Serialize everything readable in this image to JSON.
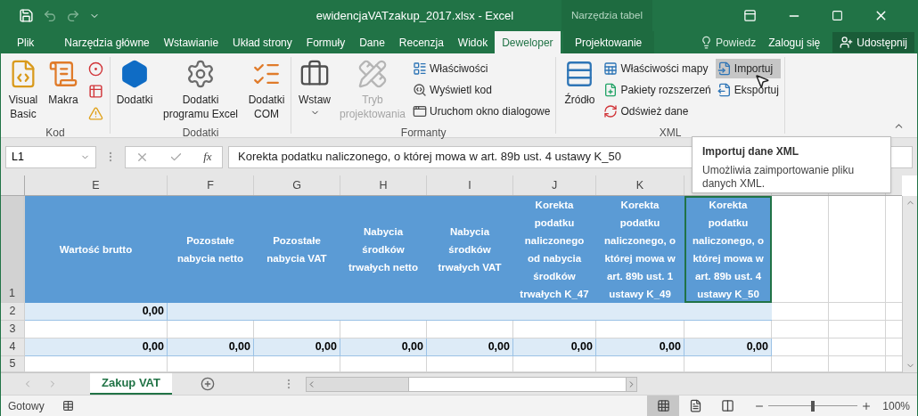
{
  "window": {
    "title": "ewidencjaVATzakup_2017.xlsx - Excel",
    "contextual_group": "Narzędzia tabel"
  },
  "ribbon_tabs": [
    {
      "label": "Plik",
      "selected": false
    },
    {
      "label": "Narzędzia główne",
      "selected": false
    },
    {
      "label": "Wstawianie",
      "selected": false
    },
    {
      "label": "Układ strony",
      "selected": false
    },
    {
      "label": "Formuły",
      "selected": false
    },
    {
      "label": "Dane",
      "selected": false
    },
    {
      "label": "Recenzja",
      "selected": false
    },
    {
      "label": "Widok",
      "selected": false
    },
    {
      "label": "Deweloper",
      "selected": true
    },
    {
      "label": "Projektowanie",
      "selected": false
    }
  ],
  "tell_me": "Powiedz",
  "sign_in": "Zaloguj się",
  "share": "Udostępnij",
  "ribbon_groups": [
    {
      "label": "Kod",
      "items": [
        {
          "kind": "large",
          "label": "Visual Basic",
          "disabled": false
        },
        {
          "kind": "large",
          "label": "Makra",
          "disabled": false
        },
        {
          "kind": "stack",
          "items": [
            {
              "kind": "icon",
              "highlighted": false
            },
            {
              "kind": "icon",
              "highlighted": false
            },
            {
              "kind": "icon",
              "highlighted": false
            }
          ]
        }
      ]
    },
    {
      "label": "Dodatki",
      "items": [
        {
          "kind": "large",
          "label": "Dodatki",
          "disabled": false
        },
        {
          "kind": "large",
          "label": "Dodatki programu Excel",
          "disabled": false
        },
        {
          "kind": "large",
          "label": "Dodatki COM",
          "disabled": false
        }
      ]
    },
    {
      "label": "Formanty",
      "items": [
        {
          "kind": "menu",
          "label": "Wstaw",
          "disabled": false
        },
        {
          "kind": "large",
          "label": "Tryb projektowania",
          "disabled": true
        },
        {
          "kind": "stack",
          "items": [
            {
              "kind": "small",
              "label": "Właściwości",
              "highlighted": false
            },
            {
              "kind": "small",
              "label": "Wyświetl kod",
              "highlighted": false
            },
            {
              "kind": "small",
              "label": "Uruchom okno dialogowe",
              "highlighted": false
            }
          ]
        }
      ]
    },
    {
      "label": "XML",
      "items": [
        {
          "kind": "large",
          "label": "Źródło",
          "disabled": false
        },
        {
          "kind": "stack",
          "items": [
            {
              "kind": "small",
              "label": "Właściwości mapy",
              "highlighted": false
            },
            {
              "kind": "small",
              "label": "Pakiety rozszerzeń",
              "highlighted": false
            },
            {
              "kind": "small",
              "label": "Odśwież dane",
              "highlighted": false
            }
          ]
        },
        {
          "kind": "stack",
          "items": [
            {
              "kind": "small",
              "label": "Importuj",
              "highlighted": true
            },
            {
              "kind": "small",
              "label": "Eksportuj",
              "highlighted": false
            }
          ]
        }
      ]
    }
  ],
  "formula_bar": {
    "name_box": "L1",
    "function_label": "fx",
    "formula": "Korekta podatku naliczonego, o której mowa w art. 89b ust. 4 ustawy K_50"
  },
  "tooltip": {
    "title": "Importuj dane XML",
    "text": "Umożliwia zaimportowanie pliku danych XML."
  },
  "sheet": {
    "columns": [
      "E",
      "F",
      "G",
      "H",
      "I",
      "J",
      "K"
    ],
    "rows": [
      {
        "number": "1",
        "kind": "header",
        "cells": [
          {
            "text": "Wartość brutto",
            "selected": false
          },
          {
            "text": "Pozostałe nabycia netto",
            "selected": false
          },
          {
            "text": "Pozostałe nabycia VAT",
            "selected": false
          },
          {
            "text": "Nabycia środków trwałych netto",
            "selected": false
          },
          {
            "text": "Nabycia środków trwałych VAT",
            "selected": false
          },
          {
            "text": "Korekta podatku naliczonego od nabycia środków trwałych K_47",
            "selected": false
          },
          {
            "text": "Korekta podatku naliczonego, o której mowa w art. 89b ust. 1 ustawy K_49",
            "selected": false
          },
          {
            "text": "Korekta podatku naliczonego, o której mowa w art. 89b ust. 4 ustawy K_50",
            "selected": true
          }
        ]
      },
      {
        "number": "2",
        "kind": "band",
        "cells": [
          {
            "text": "0,00"
          }
        ]
      },
      {
        "number": "3",
        "kind": "plain"
      },
      {
        "number": "4",
        "kind": "band",
        "cells": [
          {
            "text": "0,00"
          },
          {
            "text": "0,00"
          },
          {
            "text": "0,00"
          },
          {
            "text": "0,00"
          },
          {
            "text": "0,00"
          },
          {
            "text": "0,00"
          },
          {
            "text": "0,00"
          },
          {
            "text": "0,00"
          }
        ]
      },
      {
        "number": "5",
        "kind": "plain"
      }
    ]
  },
  "sheet_tabs": [
    {
      "label": "Zakup VAT",
      "selected": true
    }
  ],
  "status_bar": {
    "status": "Gotowy",
    "views": [
      {
        "kind": "normal",
        "selected": true
      },
      {
        "kind": "page_layout",
        "selected": false
      },
      {
        "kind": "page_break",
        "selected": false
      }
    ],
    "zoom_slider": {
      "level": 0.5
    },
    "zoom": "100%"
  }
}
